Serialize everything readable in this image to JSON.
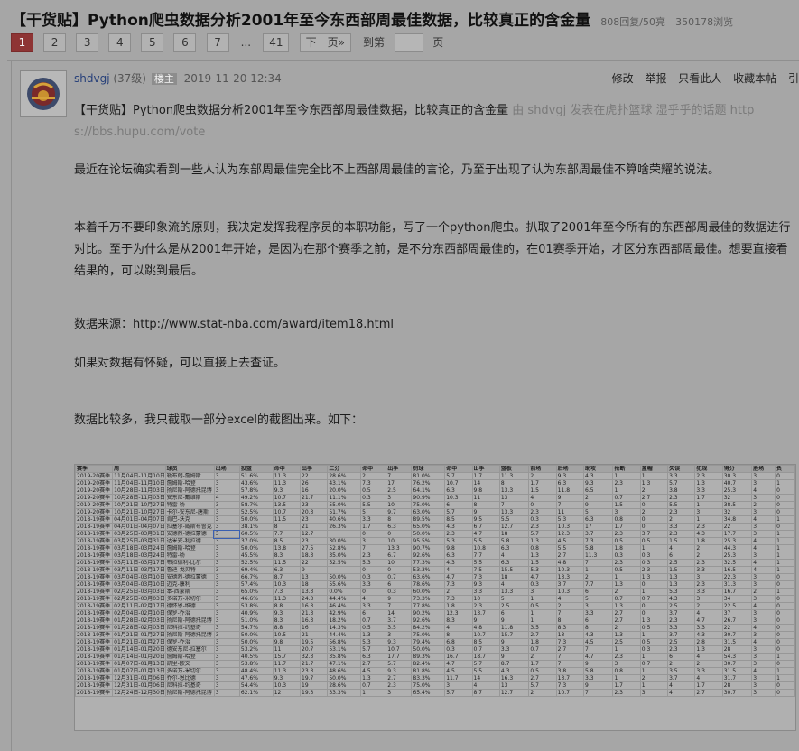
{
  "thread": {
    "title": "【干货贴】Python爬虫数据分析2001年至今东西部周最佳数据，比较真正的含金量",
    "replies": "808回复/50亮",
    "views": "350178浏览"
  },
  "pagination": {
    "pages": [
      "1",
      "2",
      "3",
      "4",
      "5",
      "6",
      "7"
    ],
    "active": "1",
    "ellipsis": "...",
    "last": "41",
    "next": "下一页»",
    "jump_label": "到第",
    "jump_unit": "页"
  },
  "post": {
    "author": "shdvgj",
    "level": "(37级)",
    "badge": "楼主",
    "time": "2019-11-20 12:34",
    "actions": [
      "修改",
      "举报",
      "只看此人",
      "收藏本帖",
      "引"
    ],
    "quote_title": "【干货贴】Python爬虫数据分析2001年至今东西部周最佳数据，比较真正的含金量",
    "quote_source_line1": " 由 shdvgj 发表在虎扑篮球 湿乎乎的话题 http",
    "quote_source_line2": "s://bbs.hupu.com/vote",
    "para1": "最近在论坛确实看到一些人认为东部周最佳完全比不上西部周最佳的言论，乃至于出现了认为东部周最佳不算啥荣耀的说法。",
    "para2": "本着千万不要印象流的原则，我决定发挥我程序员的本职功能，写了一个python爬虫。扒取了2001年至今所有的东西部周最佳的数据进行对比。至于为什么是从2001年开始，是因为在那个赛季之前，是不分东西部周最佳的，在01赛季开始，才区分东西部周最佳。想要直接看结果的，可以跳到最后。",
    "para3": "数据来源：http://www.stat-nba.com/award/item18.html",
    "para4": "如果对数据有怀疑，可以直接上去查证。",
    "para5": "数据比较多，我只截取一部分excel的截图出来。如下："
  },
  "sheet": {
    "headers": [
      "赛季",
      "周",
      "球员",
      "出场",
      "投篮",
      "命中",
      "出手",
      "三分",
      "命中",
      "出手",
      "罚球",
      "命中",
      "出手",
      "篮板",
      "前场",
      "后场",
      "助攻",
      "抢断",
      "盖帽",
      "失误",
      "犯规",
      "得分",
      "胜场",
      "负"
    ],
    "rows": [
      [
        "2019-20赛季",
        "11月04日-11月10日",
        "勒布朗-詹姆斯",
        "3",
        "51.6%",
        "11.3",
        "22",
        "28.6%",
        "2",
        "7",
        "81.0%",
        "5.7",
        "1.7",
        "11.3",
        "2",
        "9.3",
        "4.3",
        "1",
        "1",
        "3.3",
        "2.3",
        "30.3",
        "3",
        "0"
      ],
      [
        "2019-20赛季",
        "11月04日-11月10日",
        "詹姆斯-哈登",
        "3",
        "43.6%",
        "11.3",
        "26",
        "43.1%",
        "7.3",
        "17",
        "76.2%",
        "10.7",
        "14",
        "8",
        "1.7",
        "6.3",
        "9.3",
        "2.3",
        "1.3",
        "5.7",
        "1.3",
        "40.7",
        "3",
        "1"
      ],
      [
        "2019-20赛季",
        "10月28日-11月03日",
        "扬尼斯-阿德托昆博",
        "3",
        "57.8%",
        "9.3",
        "16",
        "20.0%",
        "0.5",
        "2.5",
        "64.1%",
        "6.3",
        "9.8",
        "13.3",
        "1.5",
        "11.8",
        "6.5",
        "1",
        "2",
        "3.8",
        "3.3",
        "25.3",
        "4",
        "0"
      ],
      [
        "2019-20赛季",
        "10月28日-11月03日",
        "安东尼-戴维斯",
        "4",
        "49.2%",
        "10.7",
        "21.7",
        "11.1%",
        "0.3",
        "3",
        "90.9%",
        "10.3",
        "11",
        "13",
        "4",
        "9",
        "2",
        "0.7",
        "2.7",
        "2.3",
        "1.7",
        "32",
        "3",
        "0"
      ],
      [
        "2019-20赛季",
        "10月21日-10月27日",
        "特雷-杨",
        "3",
        "58.7%",
        "13.5",
        "23",
        "55.0%",
        "5.5",
        "10",
        "75.0%",
        "6",
        "8",
        "7",
        "0",
        "7",
        "9",
        "1.5",
        "0",
        "5.5",
        "1",
        "38.5",
        "2",
        "0"
      ],
      [
        "2019-20赛季",
        "10月21日-10月27日",
        "卡尔-安东尼-唐斯",
        "3",
        "52.5%",
        "10.7",
        "20.3",
        "51.7%",
        "5",
        "9.7",
        "63.0%",
        "5.7",
        "9",
        "13.3",
        "2.3",
        "11",
        "5",
        "3",
        "2",
        "2.3",
        "3",
        "32",
        "3",
        "0"
      ],
      [
        "2018-19赛季",
        "04月01日-04月07日",
        "肯巴-沃克",
        "3",
        "50.0%",
        "11.5",
        "23",
        "40.6%",
        "3.3",
        "8",
        "89.5%",
        "8.5",
        "9.5",
        "5.5",
        "0.3",
        "5.3",
        "6.3",
        "0.8",
        "0",
        "2",
        "1",
        "34.8",
        "4",
        "1"
      ],
      [
        "2018-19赛季",
        "04月01日-04月07日",
        "拉塞尔-威斯布鲁克",
        "3",
        "38.1%",
        "8",
        "21",
        "26.3%",
        "1.7",
        "6.3",
        "65.0%",
        "4.3",
        "6.7",
        "12.7",
        "2.3",
        "10.3",
        "17",
        "1.7",
        "0",
        "3.3",
        "2.3",
        "22",
        "3",
        "0"
      ],
      [
        "2018-19赛季",
        "03月25日-03月31日",
        "安德烈-德拉蒙德",
        "3",
        "60.5%",
        "7.7",
        "12.7",
        "",
        "0",
        "0",
        "50.0%",
        "2.3",
        "4.7",
        "18",
        "5.7",
        "12.3",
        "3.7",
        "2.3",
        "3.7",
        "2.3",
        "4.3",
        "17.7",
        "3",
        "1"
      ],
      [
        "2018-19赛季",
        "03月25日-03月31日",
        "达米安-利拉德",
        "3",
        "37.0%",
        "8.5",
        "23",
        "30.0%",
        "3",
        "10",
        "95.5%",
        "5.3",
        "5.5",
        "5.8",
        "1.3",
        "4.5",
        "7.3",
        "0.5",
        "0.5",
        "1.5",
        "1.8",
        "25.3",
        "4",
        "1"
      ],
      [
        "2018-19赛季",
        "03月18日-03月24日",
        "詹姆斯-哈登",
        "3",
        "50.0%",
        "13.8",
        "27.5",
        "52.8%",
        "7",
        "13.3",
        "90.7%",
        "9.8",
        "10.8",
        "6.3",
        "0.8",
        "5.5",
        "5.8",
        "1.8",
        "1",
        "4",
        "2",
        "44.3",
        "4",
        "1"
      ],
      [
        "2018-19赛季",
        "03月18日-03月24日",
        "特雷-杨",
        "3",
        "45.5%",
        "8.3",
        "18.3",
        "35.0%",
        "2.3",
        "6.7",
        "92.6%",
        "6.3",
        "7.7",
        "4",
        "1.3",
        "2.7",
        "11.3",
        "0.3",
        "0.3",
        "6",
        "2",
        "25.3",
        "3",
        "1"
      ],
      [
        "2018-19赛季",
        "03月11日-03月17日",
        "布拉德利-比尔",
        "3",
        "52.5%",
        "11.5",
        "22",
        "52.5%",
        "5.3",
        "10",
        "77.3%",
        "4.3",
        "5.5",
        "6.3",
        "1.5",
        "4.8",
        "7",
        "2.3",
        "0.3",
        "2.5",
        "2.3",
        "32.5",
        "4",
        "1"
      ],
      [
        "2018-19赛季",
        "03月11日-03月17日",
        "鲁迪-戈贝特",
        "3",
        "69.4%",
        "6.3",
        "9",
        "",
        "0",
        "0",
        "53.3%",
        "4",
        "7.5",
        "15.5",
        "5.3",
        "10.3",
        "1",
        "0.5",
        "2.3",
        "1.5",
        "3.3",
        "16.5",
        "4",
        "1"
      ],
      [
        "2018-19赛季",
        "03月04日-03月10日",
        "安德烈-德拉蒙德",
        "3",
        "66.7%",
        "8.7",
        "13",
        "50.0%",
        "0.3",
        "0.7",
        "63.6%",
        "4.7",
        "7.3",
        "18",
        "4.7",
        "13.3",
        "2",
        "1",
        "1.3",
        "1.3",
        "3",
        "22.3",
        "3",
        "0"
      ],
      [
        "2018-19赛季",
        "03月04日-03月10日",
        "迈克-康利",
        "3",
        "57.4%",
        "10.3",
        "18",
        "55.6%",
        "3.3",
        "6",
        "78.6%",
        "7.3",
        "9.3",
        "4",
        "0.3",
        "3.7",
        "7.7",
        "1.3",
        "0",
        "1.3",
        "2.3",
        "31.3",
        "3",
        "0"
      ],
      [
        "2018-19赛季",
        "02月25日-03月03日",
        "本-西蒙斯",
        "3",
        "65.0%",
        "7.3",
        "13.3",
        "0.0%",
        "0",
        "0.3",
        "60.0%",
        "2",
        "3.3",
        "13.3",
        "3",
        "10.3",
        "6",
        "2",
        "1",
        "5.3",
        "3.3",
        "16.7",
        "2",
        "1"
      ],
      [
        "2018-19赛季",
        "02月25日-03月03日",
        "多诺万-米切尔",
        "3",
        "46.6%",
        "11.3",
        "24.3",
        "44.4%",
        "4",
        "9",
        "73.3%",
        "7.3",
        "10",
        "5",
        "1",
        "4",
        "5",
        "0.7",
        "0.7",
        "4.3",
        "3",
        "34",
        "3",
        "0"
      ],
      [
        "2018-19赛季",
        "02月11日-02月17日",
        "德怀恩-维德",
        "3",
        "53.8%",
        "8.8",
        "16.3",
        "46.4%",
        "3.3",
        "7",
        "77.8%",
        "1.8",
        "2.3",
        "2.5",
        "0.5",
        "2",
        "3",
        "1.3",
        "0",
        "2.5",
        "2",
        "22.5",
        "4",
        "0"
      ],
      [
        "2018-19赛季",
        "02月04日-02月10日",
        "保罗-乔治",
        "3",
        "40.9%",
        "9.3",
        "21.3",
        "42.9%",
        "6",
        "14",
        "90.2%",
        "12.3",
        "13.7",
        "6",
        "1",
        "7",
        "3.3",
        "2.7",
        "0",
        "3.7",
        "4",
        "37",
        "3",
        "0"
      ],
      [
        "2018-19赛季",
        "01月28日-02月03日",
        "扬尼斯-阿德托昆博",
        "3",
        "51.0%",
        "8.3",
        "16.3",
        "18.2%",
        "0.7",
        "3.7",
        "92.6%",
        "8.3",
        "9",
        "9",
        "1",
        "8",
        "6",
        "2.7",
        "1.3",
        "2.3",
        "4.7",
        "26.7",
        "3",
        "0"
      ],
      [
        "2018-19赛季",
        "01月28日-02月03日",
        "尼科拉-约基奇",
        "3",
        "54.7%",
        "8.8",
        "16",
        "14.3%",
        "0.5",
        "3.5",
        "84.2%",
        "4",
        "4.8",
        "11.8",
        "3.5",
        "8.3",
        "8",
        "2",
        "0.5",
        "3.3",
        "3.3",
        "22",
        "4",
        "0"
      ],
      [
        "2018-19赛季",
        "01月21日-01月27日",
        "扬尼斯-阿德托昆博",
        "3",
        "50.0%",
        "10.5",
        "21",
        "44.4%",
        "1.3",
        "3",
        "75.0%",
        "8",
        "10.7",
        "15.7",
        "2.7",
        "13",
        "4.3",
        "1.3",
        "1",
        "3.7",
        "4.3",
        "30.7",
        "3",
        "0"
      ],
      [
        "2018-19赛季",
        "01月21日-01月27日",
        "保罗-乔治",
        "3",
        "50.0%",
        "9.8",
        "19.5",
        "56.8%",
        "5.3",
        "9.3",
        "79.4%",
        "6.8",
        "8.5",
        "9",
        "1.8",
        "7.3",
        "4.5",
        "2.5",
        "0.5",
        "2.5",
        "2.8",
        "31.5",
        "4",
        "0"
      ],
      [
        "2018-19赛季",
        "01月14日-01月20日",
        "德安东尼-拉塞尔",
        "3",
        "53.2%",
        "11",
        "20.7",
        "53.1%",
        "5.7",
        "10.7",
        "50.0%",
        "0.3",
        "0.7",
        "3.3",
        "0.7",
        "2.7",
        "7",
        "1",
        "0.3",
        "2.3",
        "1.3",
        "28",
        "3",
        "0"
      ],
      [
        "2018-19赛季",
        "01月14日-01月20日",
        "詹姆斯-哈登",
        "3",
        "40.5%",
        "15.7",
        "32.3",
        "35.8%",
        "6.3",
        "17.7",
        "89.3%",
        "16.7",
        "18.7",
        "9",
        "2",
        "7",
        "4.7",
        "2.3",
        "1",
        "6",
        "4",
        "54.3",
        "3",
        "1"
      ],
      [
        "2018-19赛季",
        "01月07日-01月13日",
        "凯里-欧文",
        "3",
        "53.8%",
        "11.7",
        "21.7",
        "47.1%",
        "2.7",
        "5.7",
        "82.4%",
        "4.7",
        "5.7",
        "8.7",
        "1.7",
        "7",
        "9",
        "3",
        "0.7",
        "2",
        "2",
        "30.7",
        "3",
        "0"
      ],
      [
        "2018-19赛季",
        "01月07日-01月13日",
        "多诺万-米切尔",
        "3",
        "48.4%",
        "11.3",
        "23.3",
        "48.6%",
        "4.5",
        "9.3",
        "81.8%",
        "4.5",
        "5.5",
        "4.3",
        "0.5",
        "3.8",
        "5.8",
        "0.8",
        "1",
        "3.5",
        "3.3",
        "31.5",
        "4",
        "1"
      ],
      [
        "2018-19赛季",
        "12月31日-01月06日",
        "乔尔-恩比德",
        "3",
        "47.6%",
        "9.3",
        "19.7",
        "50.0%",
        "1.3",
        "2.7",
        "83.3%",
        "11.7",
        "14",
        "16.3",
        "2.7",
        "13.7",
        "3.3",
        "1",
        "2",
        "3.7",
        "4",
        "31.7",
        "3",
        "1"
      ],
      [
        "2018-19赛季",
        "12月31日-01月06日",
        "尼科拉-约基奇",
        "3",
        "54.4%",
        "10.3",
        "19",
        "28.6%",
        "0.7",
        "2.3",
        "75.0%",
        "3",
        "4",
        "13",
        "5.7",
        "7.3",
        "9",
        "1.7",
        "1",
        "4",
        "1.7",
        "28",
        "3",
        "0"
      ],
      [
        "2018-19赛季",
        "12月24日-12月30日",
        "扬尼斯-阿德托昆博",
        "3",
        "62.1%",
        "12",
        "19.3",
        "33.3%",
        "1",
        "3",
        "65.4%",
        "5.7",
        "8.7",
        "12.7",
        "2",
        "10.7",
        "7",
        "2.3",
        "3",
        "4",
        "2.7",
        "30.7",
        "3",
        "0"
      ]
    ]
  }
}
